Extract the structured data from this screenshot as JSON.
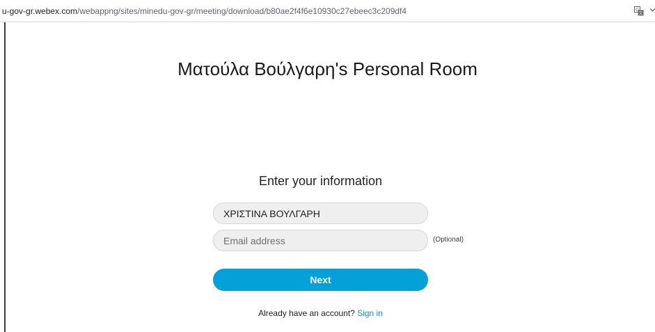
{
  "browser": {
    "url_host": "u-gov-gr.webex.com",
    "url_path": "/webappng/sites/minedu-gov-gr/meeting/download/b80ae2f4f6e10930c27ebeec3c209df4",
    "translate_icon": "translate-icon",
    "menu_icon": "chevron-down-icon"
  },
  "page": {
    "title": "Ματούλα Βούλγαρη's Personal Room"
  },
  "form": {
    "heading": "Enter your information",
    "name_value": "ΧΡΙΣΤΙΝΑ ΒΟΥΛΓΑΡΗ",
    "email_placeholder": "Email address",
    "optional_label": "(Optional)",
    "next_label": "Next",
    "account_prompt": "Already have an account?",
    "signin_label": "Sign in"
  },
  "colors": {
    "accent": "#04a0d8",
    "link": "#0a8fd1"
  }
}
